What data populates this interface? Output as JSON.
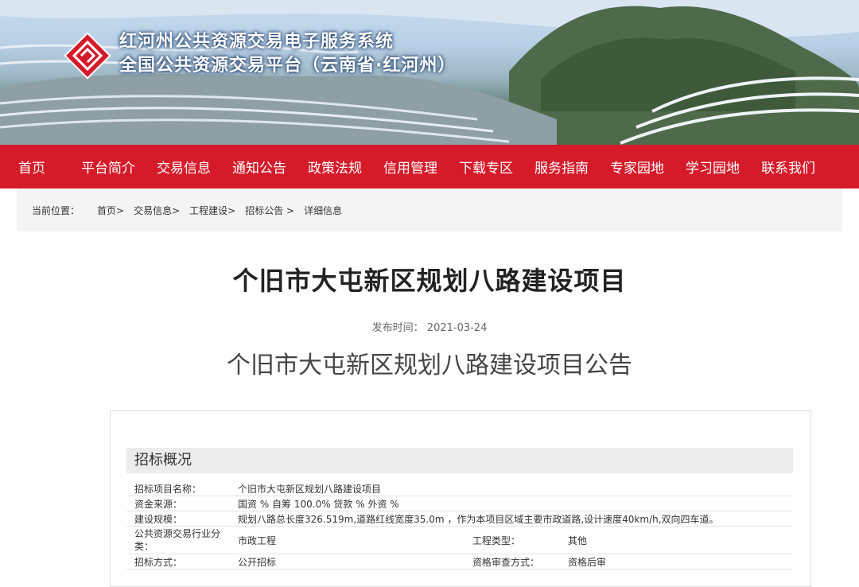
{
  "header": {
    "title_line1": "红河州公共资源交易电子服务系统",
    "title_line2": "全国公共资源交易平台（云南省·红河州）"
  },
  "nav": [
    "首页",
    "平台简介",
    "交易信息",
    "通知公告",
    "政策法规",
    "信用管理",
    "下载专区",
    "服务指南",
    "专家园地",
    "学习园地",
    "联系我们"
  ],
  "breadcrumb": {
    "prefix": "当前位置：",
    "items": [
      "首页>",
      "交易信息>",
      "工程建设>",
      "招标公告 >",
      "详细信息"
    ]
  },
  "article": {
    "title": "个旧市大屯新区规划八路建设项目",
    "publish_label": "发布时间：",
    "publish_date": "2021-03-24",
    "notice_title": "个旧市大屯新区规划八路建设项目公告"
  },
  "overview": {
    "heading": "招标概况",
    "rows": [
      {
        "label": "招标项目名称：",
        "value": "个旧市大屯新区规划八路建设项目"
      },
      {
        "label": "资金来源：",
        "value": "国资 % 自筹 100.0% 贷款 % 外资 %"
      },
      {
        "label": "建设规模：",
        "value": "规划八路总长度326.519m,道路红线宽度35.0m ，作为本项目区域主要市政道路,设计速度40km/h,双向四车道。"
      },
      {
        "label": "公共资源交易行业分类：",
        "value": "市政工程",
        "label2": "工程类型：",
        "value2": "其他"
      },
      {
        "label": "招标方式：",
        "value": "公开招标",
        "label2": "资格审查方式：",
        "value2": "资格后审"
      }
    ]
  }
}
